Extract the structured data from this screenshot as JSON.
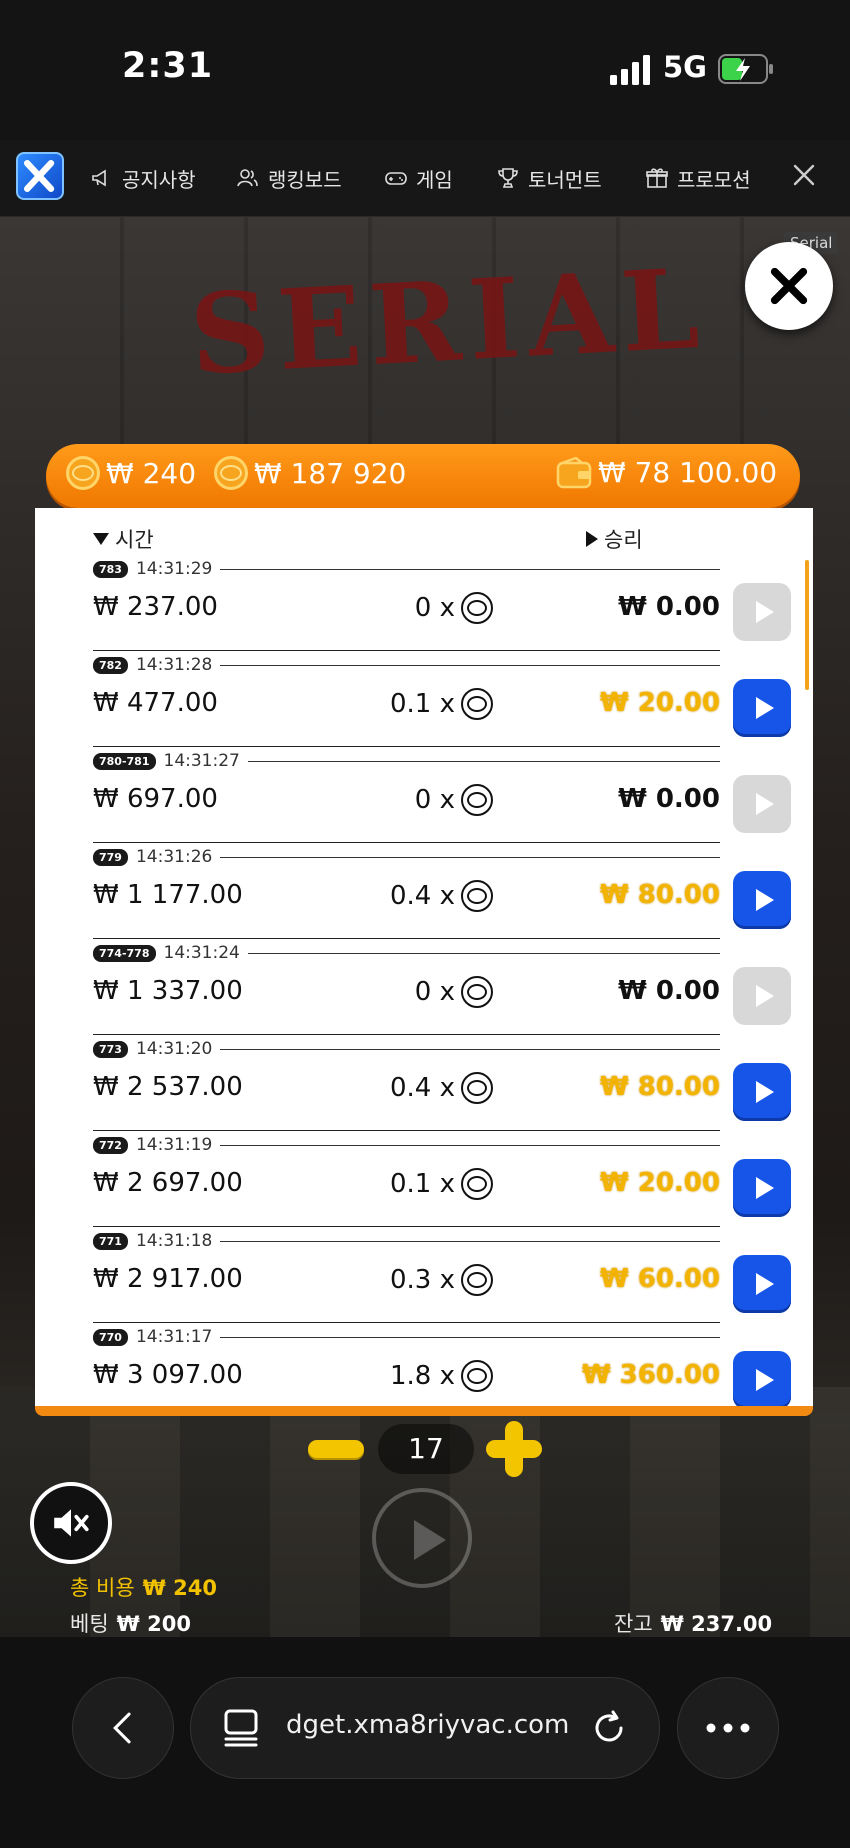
{
  "status_bar": {
    "time": "2:31",
    "network": "5G"
  },
  "nav": {
    "items": [
      {
        "label": "공지사항",
        "icon": "megaphone-icon"
      },
      {
        "label": "랭킹보드",
        "icon": "users-icon"
      },
      {
        "label": "게임",
        "icon": "gamepad-icon"
      },
      {
        "label": "토너먼트",
        "icon": "trophy-icon"
      },
      {
        "label": "프로모션",
        "icon": "gift-icon"
      }
    ]
  },
  "game": {
    "title_art": "SERIAL",
    "tag": "Serial",
    "balance_bar": {
      "bet_cost": "₩ 240",
      "total": "₩ 187 920",
      "wallet": "₩ 78 100.00"
    },
    "history": {
      "col_time": "시간",
      "col_win": "승리",
      "rows": [
        {
          "id": "783",
          "time": "14:31:29",
          "amount": "₩ 237.00",
          "mult": "0 x",
          "win": "₩ 0.00",
          "won": false
        },
        {
          "id": "782",
          "time": "14:31:28",
          "amount": "₩ 477.00",
          "mult": "0.1 x",
          "win": "₩ 20.00",
          "won": true
        },
        {
          "id": "780-781",
          "time": "14:31:27",
          "amount": "₩ 697.00",
          "mult": "0 x",
          "win": "₩ 0.00",
          "won": false
        },
        {
          "id": "779",
          "time": "14:31:26",
          "amount": "₩ 1 177.00",
          "mult": "0.4 x",
          "win": "₩ 80.00",
          "won": true
        },
        {
          "id": "774-778",
          "time": "14:31:24",
          "amount": "₩ 1 337.00",
          "mult": "0 x",
          "win": "₩ 0.00",
          "won": false
        },
        {
          "id": "773",
          "time": "14:31:20",
          "amount": "₩ 2 537.00",
          "mult": "0.4 x",
          "win": "₩ 80.00",
          "won": true
        },
        {
          "id": "772",
          "time": "14:31:19",
          "amount": "₩ 2 697.00",
          "mult": "0.1 x",
          "win": "₩ 20.00",
          "won": true
        },
        {
          "id": "771",
          "time": "14:31:18",
          "amount": "₩ 2 917.00",
          "mult": "0.3 x",
          "win": "₩ 60.00",
          "won": true
        },
        {
          "id": "770",
          "time": "14:31:17",
          "amount": "₩ 3 097.00",
          "mult": "1.8 x",
          "win": "₩ 360.00",
          "won": true
        }
      ]
    },
    "stepper_count": "17",
    "total_cost_label": "총 비용",
    "total_cost_value": "₩ 240",
    "bet_label": "베팅",
    "bet_value": "₩ 200",
    "balance_label": "잔고",
    "balance_value": "₩ 237.00"
  },
  "browser": {
    "url": "dget.xma8riyvac.com"
  },
  "colors": {
    "accent_orange": "#f07800",
    "play_blue": "#1655e8",
    "win_gold": "#f2b400"
  }
}
